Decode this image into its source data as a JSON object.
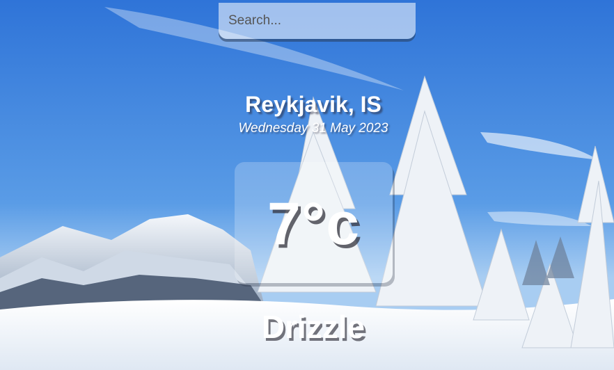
{
  "search": {
    "placeholder": "Search...",
    "value": ""
  },
  "location": {
    "label": "Reykjavik, IS"
  },
  "date": {
    "label": "Wednesday 31 May 2023"
  },
  "weather": {
    "temperature": "7°c",
    "condition": "Drizzle"
  },
  "background": {
    "description_icon": "snowy-mountain-forest-image",
    "sky_color": "#3f86e0",
    "snow_color": "#f2f6fb"
  }
}
